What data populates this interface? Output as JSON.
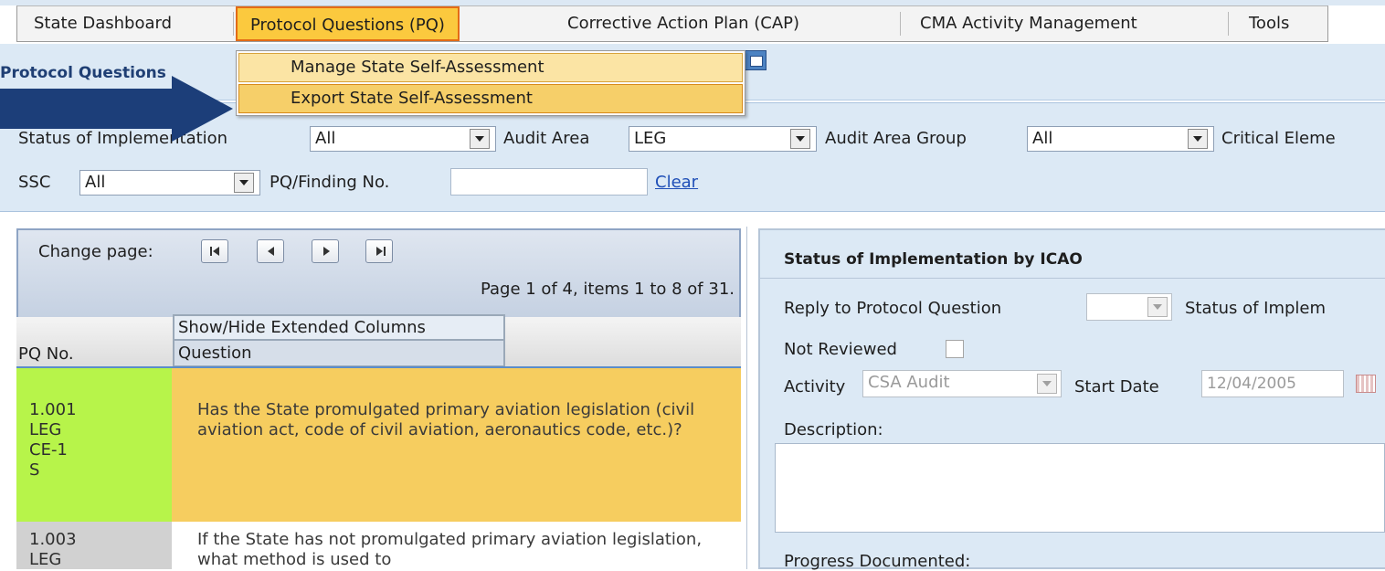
{
  "menu": {
    "items": [
      {
        "label": "State Dashboard"
      },
      {
        "label": "Protocol Questions (PQ)"
      },
      {
        "label": "Corrective Action Plan (CAP)"
      },
      {
        "label": "CMA Activity Management"
      },
      {
        "label": "Tools"
      }
    ],
    "active_index": 1
  },
  "header": {
    "section_title": "Protocol Questions"
  },
  "dropdown": {
    "items": [
      {
        "label": "Manage State Self-Assessment"
      },
      {
        "label": "Export State Self-Assessment"
      }
    ],
    "highlighted_index": 1
  },
  "filters": {
    "status_label": "Status of Implementation",
    "status_value": "All",
    "audit_area_label": "Audit Area",
    "audit_area_value": "LEG",
    "audit_area_group_label": "Audit Area Group",
    "audit_area_group_value": "All",
    "critical_element_label": "Critical Eleme",
    "ssc_label": "SSC",
    "ssc_value": "All",
    "pq_finding_label": "PQ/Finding No.",
    "pq_finding_value": "",
    "clear_label": "Clear"
  },
  "pager": {
    "change_page_label": "Change page:",
    "summary": "Page 1 of 4, items 1 to 8 of 31."
  },
  "grid": {
    "show_hide_label": "Show/Hide Extended Columns",
    "col_pq_no": "PQ No.",
    "col_question": "Question",
    "rows": [
      {
        "pq_no": "1.001",
        "area": "LEG",
        "ce": "CE-1",
        "status": "S",
        "question": "Has the State promulgated primary aviation legislation (civil aviation act, code of civil aviation, aeronautics code, etc.)?"
      },
      {
        "pq_no": "1.003",
        "area": "LEG",
        "question": "If the State has not promulgated primary aviation legislation, what method is used to"
      }
    ]
  },
  "detail": {
    "title": "Status of Implementation by ICAO",
    "reply_label": "Reply to Protocol Question",
    "reply_value": "",
    "status_label": "Status of Implem",
    "not_reviewed_label": "Not Reviewed",
    "activity_label": "Activity",
    "activity_value": "CSA Audit",
    "start_date_label": "Start Date",
    "start_date_value": "12/04/2005",
    "description_label": "Description:",
    "description_value": "",
    "progress_label": "Progress Documented:"
  },
  "colors": {
    "active_menu_bg": "#fbc93e",
    "active_menu_border": "#e36b16",
    "row_status_green": "#b7f44a",
    "row_selected": "#f6cd5f",
    "arrow": "#1c3e79",
    "panel_bg": "#dce9f5"
  },
  "icons": [
    "first-page-icon",
    "prev-page-icon",
    "next-page-icon",
    "last-page-icon",
    "maximize-window-icon",
    "calendar-icon",
    "arrow-pointer"
  ]
}
